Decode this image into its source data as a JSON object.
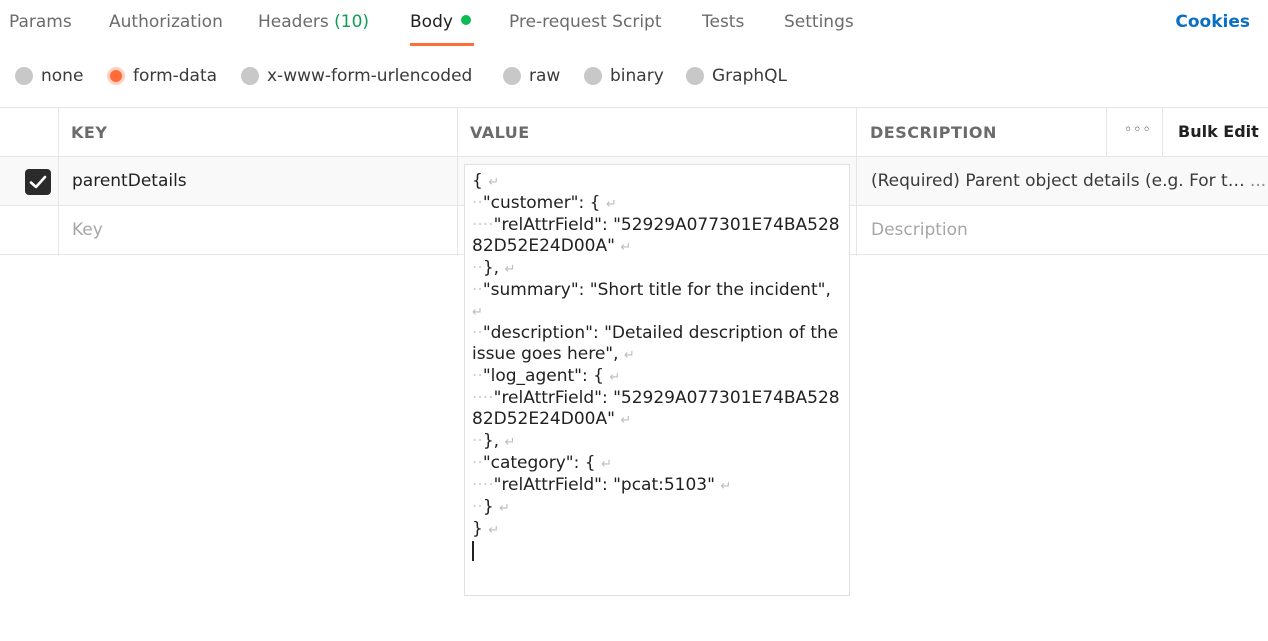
{
  "tabs": {
    "items": [
      {
        "label": "Params"
      },
      {
        "label": "Authorization"
      },
      {
        "label": "Headers",
        "count": "(10)"
      },
      {
        "label": "Body"
      },
      {
        "label": "Pre-request Script"
      },
      {
        "label": "Tests"
      },
      {
        "label": "Settings"
      }
    ],
    "active": "Body",
    "cookies_label": "Cookies"
  },
  "body_types": {
    "options": [
      "none",
      "form-data",
      "x-www-form-urlencoded",
      "raw",
      "binary",
      "GraphQL"
    ],
    "selected": "form-data"
  },
  "table": {
    "headers": {
      "key": "KEY",
      "value": "VALUE",
      "description": "DESCRIPTION",
      "bulk_edit": "Bulk Edit"
    },
    "rows": [
      {
        "checked": true,
        "key": "parentDetails",
        "description": "(Required) Parent object details (e.g. For ti...",
        "description_more": "..."
      }
    ],
    "new_row": {
      "key_placeholder": "Key",
      "description_placeholder": "Description"
    }
  },
  "value_editor": {
    "lines": [
      "{",
      "  \"customer\": {",
      "    \"relAttrField\": \"52929A077301E74BA52882D52E24D00A\"",
      "  },",
      "  \"summary\": \"Short title for the incident\",",
      "  \"description\": \"Detailed description of the issue goes here\",",
      "  \"log_agent\": {",
      "    \"relAttrField\": \"52929A077301E74BA52882D52E24D00A\"",
      "  },",
      "  \"category\": {",
      "    \"relAttrField\": \"pcat:5103\"",
      "  }",
      "}"
    ]
  },
  "colors": {
    "accent": "#ff6c37",
    "link": "#0b6ec5",
    "status_green": "#0cbb52"
  }
}
